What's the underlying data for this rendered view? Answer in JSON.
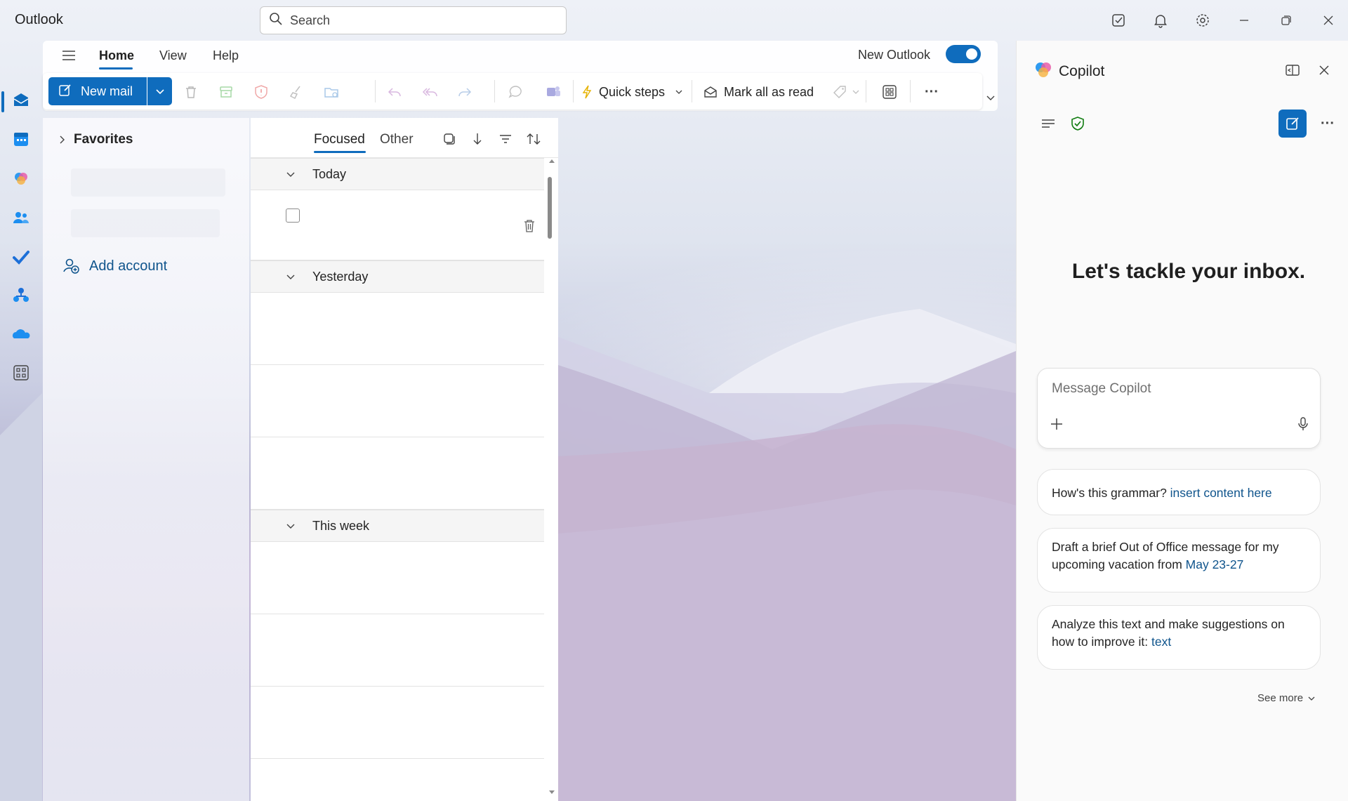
{
  "app": {
    "title": "Outlook"
  },
  "search": {
    "placeholder": "Search"
  },
  "titlebar_icons": [
    "todo-icon",
    "bell-icon",
    "gear-icon",
    "minimize-icon",
    "restore-icon",
    "close-icon"
  ],
  "rail": {
    "items": [
      "mail-icon",
      "calendar-icon",
      "copilot-icon",
      "people-icon",
      "todo-check-icon",
      "org-icon",
      "onedrive-icon",
      "more-apps-icon"
    ]
  },
  "ribbon": {
    "tabs": [
      "Home",
      "View",
      "Help"
    ],
    "active_tab": "Home",
    "new_outlook_label": "New Outlook",
    "new_outlook_on": true,
    "new_mail_label": "New mail",
    "quick_steps_label": "Quick steps",
    "mark_all_read_label": "Mark all as read",
    "more_label": "···"
  },
  "folders": {
    "favorites_label": "Favorites",
    "add_account_label": "Add account"
  },
  "message_list": {
    "tabs": [
      "Focused",
      "Other"
    ],
    "active_tab": "Focused",
    "groups": [
      {
        "label": "Today",
        "rows": 1
      },
      {
        "label": "Yesterday",
        "rows": 3
      },
      {
        "label": "This week",
        "rows": 4
      }
    ]
  },
  "copilot": {
    "title": "Copilot",
    "headline": "Let's tackle your inbox.",
    "input_placeholder": "Message Copilot",
    "suggestions": [
      {
        "text": "How's this grammar? ",
        "link": "insert content here"
      },
      {
        "text": "Draft a brief Out of Office message for my upcoming vacation from ",
        "link": "May 23-27"
      },
      {
        "text": "Analyze this text and make suggestions on how to improve it: ",
        "link": "text"
      }
    ],
    "see_more_label": "See more"
  },
  "colors": {
    "accent": "#0f6cbd",
    "link": "#0f548c"
  }
}
